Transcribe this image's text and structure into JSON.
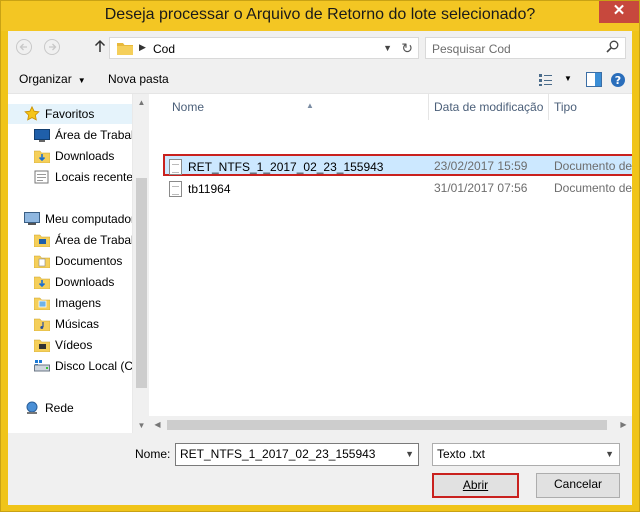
{
  "window": {
    "title": "Deseja processar o Arquivo de Retorno do lote selecionado?",
    "close_glyph": "✕"
  },
  "address_bar": {
    "breadcrumb": "Cod",
    "search_placeholder": "Pesquisar Cod"
  },
  "toolbar": {
    "organize_label": "Organizar",
    "new_folder_label": "Nova pasta"
  },
  "nav": {
    "items": [
      {
        "label": "Favoritos",
        "icon": "star-icon",
        "group": true
      },
      {
        "label": "Área de Trabalho",
        "icon": "desktop-icon"
      },
      {
        "label": "Downloads",
        "icon": "downloads-icon"
      },
      {
        "label": "Locais recentes",
        "icon": "recent-places-icon"
      },
      {
        "label": "Meu computador",
        "icon": "computer-icon",
        "group": true
      },
      {
        "label": "Área de Trabalho",
        "icon": "desktop-folder-icon"
      },
      {
        "label": "Documentos",
        "icon": "documents-icon"
      },
      {
        "label": "Downloads",
        "icon": "downloads-icon"
      },
      {
        "label": "Imagens",
        "icon": "pictures-icon"
      },
      {
        "label": "Músicas",
        "icon": "music-icon"
      },
      {
        "label": "Vídeos",
        "icon": "videos-icon"
      },
      {
        "label": "Disco Local (C:)",
        "icon": "local-disk-icon"
      },
      {
        "label": "Rede",
        "icon": "network-icon",
        "group": true
      }
    ]
  },
  "file_list": {
    "columns": [
      "Nome",
      "Data de modificação",
      "Tipo"
    ],
    "rows": [
      {
        "name": "RET_NTFS_1_2017_02_23_155943",
        "modified": "23/02/2017 15:59",
        "type": "Documento de Texto",
        "selected": true
      },
      {
        "name": "tb11964",
        "modified": "31/01/2017 07:56",
        "type": "Documento de Texto",
        "selected": false
      }
    ]
  },
  "footer": {
    "name_label": "Nome:",
    "file_name_value": "RET_NTFS_1_2017_02_23_155943",
    "file_type_value": "Texto .txt",
    "open_label": "Abrir",
    "cancel_label": "Cancelar"
  },
  "colors": {
    "title_bar": "#f3c623",
    "highlight_border": "#c9211e",
    "selection": "#cce8ff"
  }
}
